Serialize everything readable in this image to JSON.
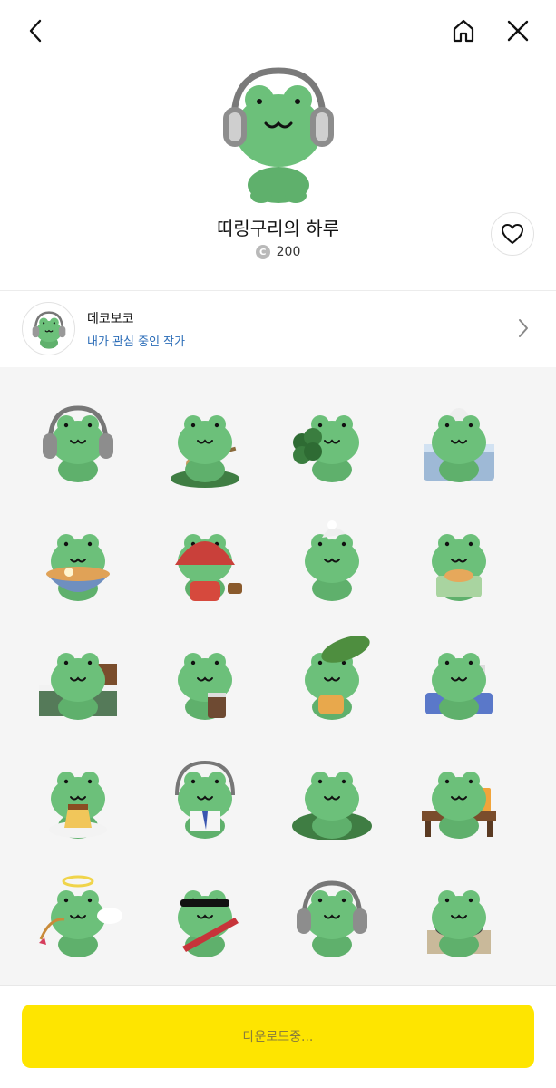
{
  "nav": {
    "back_icon": "chevron-left-icon",
    "home_icon": "home-icon",
    "close_icon": "close-icon"
  },
  "emoticon": {
    "title": "띠링구리의 하루",
    "coin_symbol": "C",
    "price": "200",
    "like_icon": "heart-outline-icon"
  },
  "author": {
    "name": "데코보코",
    "subtitle": "내가 관심 중인 작가"
  },
  "stickers": [
    {
      "name": "frog-headphones",
      "prop": "headphones"
    },
    {
      "name": "frog-ukulele",
      "prop": "ukulele"
    },
    {
      "name": "frog-clover",
      "prop": "clover"
    },
    {
      "name": "frog-bath",
      "prop": "bath"
    },
    {
      "name": "frog-ramen",
      "prop": "ramen"
    },
    {
      "name": "frog-strawberry-hood",
      "prop": "hood"
    },
    {
      "name": "frog-sleepy-nightcap",
      "prop": "nightcap"
    },
    {
      "name": "frog-pancake",
      "prop": "pancake"
    },
    {
      "name": "frog-bed",
      "prop": "bed"
    },
    {
      "name": "frog-coffee",
      "prop": "coffee"
    },
    {
      "name": "frog-leaf-umbrella",
      "prop": "leaf"
    },
    {
      "name": "frog-study-desk",
      "prop": "desk"
    },
    {
      "name": "frog-pudding",
      "prop": "pudding"
    },
    {
      "name": "frog-office-tie",
      "prop": "tie"
    },
    {
      "name": "frog-lily-pad",
      "prop": "lilypad"
    },
    {
      "name": "frog-dumplings-juice",
      "prop": "table"
    },
    {
      "name": "frog-cupid",
      "prop": "cupid"
    },
    {
      "name": "frog-guitar-sunglasses",
      "prop": "guitar"
    },
    {
      "name": "frog-headphones-sleepy",
      "prop": "headphones"
    },
    {
      "name": "frog-hotpot",
      "prop": "hotpot"
    }
  ],
  "footer": {
    "download_label": "다운로드중..."
  },
  "colors": {
    "frog": "#6cc07a",
    "accent_yellow": "#fee500",
    "link_blue": "#2b6db8"
  }
}
